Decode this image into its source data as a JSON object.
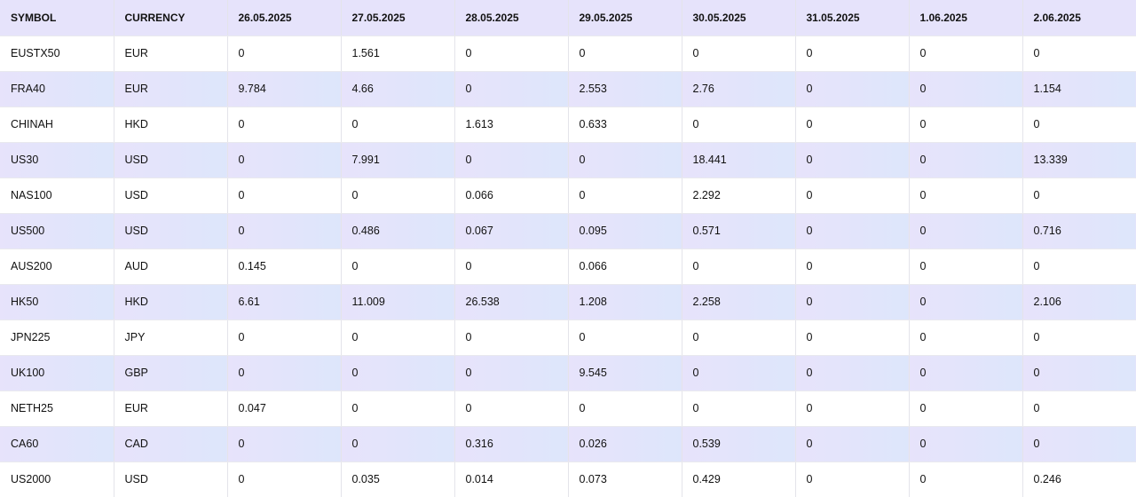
{
  "table": {
    "headers": [
      "SYMBOL",
      "CURRENCY",
      "26.05.2025",
      "27.05.2025",
      "28.05.2025",
      "29.05.2025",
      "30.05.2025",
      "31.05.2025",
      "1.06.2025",
      "2.06.2025"
    ],
    "rows": [
      [
        "EUSTX50",
        "EUR",
        "0",
        "1.561",
        "0",
        "0",
        "0",
        "0",
        "0",
        "0"
      ],
      [
        "FRA40",
        "EUR",
        "9.784",
        "4.66",
        "0",
        "2.553",
        "2.76",
        "0",
        "0",
        "1.154"
      ],
      [
        "CHINAH",
        "HKD",
        "0",
        "0",
        "1.613",
        "0.633",
        "0",
        "0",
        "0",
        "0"
      ],
      [
        "US30",
        "USD",
        "0",
        "7.991",
        "0",
        "0",
        "18.441",
        "0",
        "0",
        "13.339"
      ],
      [
        "NAS100",
        "USD",
        "0",
        "0",
        "0.066",
        "0",
        "2.292",
        "0",
        "0",
        "0"
      ],
      [
        "US500",
        "USD",
        "0",
        "0.486",
        "0.067",
        "0.095",
        "0.571",
        "0",
        "0",
        "0.716"
      ],
      [
        "AUS200",
        "AUD",
        "0.145",
        "0",
        "0",
        "0.066",
        "0",
        "0",
        "0",
        "0"
      ],
      [
        "HK50",
        "HKD",
        "6.61",
        "11.009",
        "26.538",
        "1.208",
        "2.258",
        "0",
        "0",
        "2.106"
      ],
      [
        "JPN225",
        "JPY",
        "0",
        "0",
        "0",
        "0",
        "0",
        "0",
        "0",
        "0"
      ],
      [
        "UK100",
        "GBP",
        "0",
        "0",
        "0",
        "9.545",
        "0",
        "0",
        "0",
        "0"
      ],
      [
        "NETH25",
        "EUR",
        "0.047",
        "0",
        "0",
        "0",
        "0",
        "0",
        "0",
        "0"
      ],
      [
        "CA60",
        "CAD",
        "0",
        "0",
        "0.316",
        "0.026",
        "0.539",
        "0",
        "0",
        "0"
      ],
      [
        "US2000",
        "USD",
        "0",
        "0.035",
        "0.014",
        "0.073",
        "0.429",
        "0",
        "0",
        "0.246"
      ]
    ]
  },
  "colors": {
    "header_bg": "#e6e3fb",
    "stripe_bg": "#e3e4fb",
    "row_bg": "#ffffff",
    "text": "#111111"
  }
}
